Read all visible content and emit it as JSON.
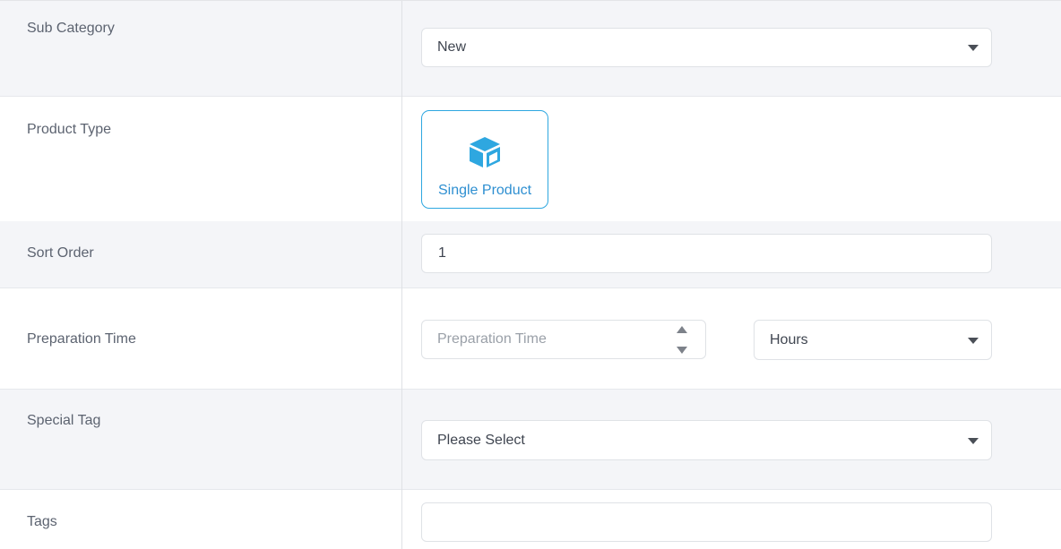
{
  "form": {
    "sub_category": {
      "label": "Sub Category",
      "value": "New"
    },
    "product_type": {
      "label": "Product Type",
      "option": "Single Product",
      "icon": "cube-icon",
      "accent": "#2ea7e0"
    },
    "sort_order": {
      "label": "Sort Order",
      "value": "1"
    },
    "preparation_time": {
      "label": "Preparation Time",
      "placeholder": "Preparation Time",
      "unit": "Hours"
    },
    "special_tag": {
      "label": "Special Tag",
      "value": "Please Select"
    },
    "tags": {
      "label": "Tags",
      "value": ""
    }
  }
}
